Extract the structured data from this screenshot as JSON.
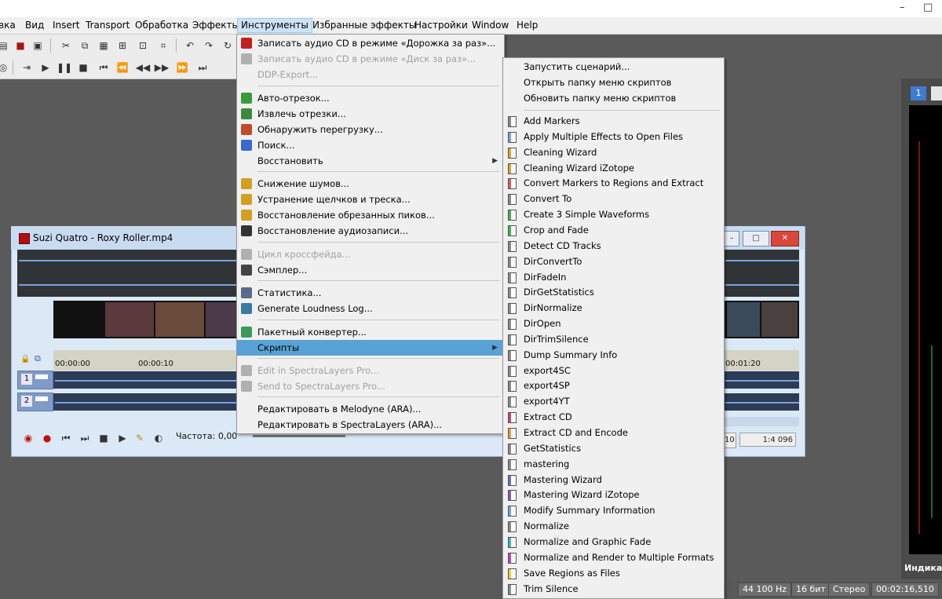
{
  "menubar": {
    "items": [
      "вка",
      "Вид",
      "Insert",
      "Transport",
      "Обработка",
      "Эффекты",
      "Инструменты",
      "Избранные эффекты",
      "Настройки",
      "Window",
      "Help"
    ],
    "active": "Инструменты",
    "window_controls": {
      "minimize": "–",
      "maximize": "□"
    }
  },
  "tools_menu": {
    "items": [
      {
        "label": "Записать аудио CD  в режиме «Дорожка за раз»...",
        "icon": "cd-record-icon",
        "enabled": true
      },
      {
        "label": "Записать аудио CD  в режиме «Диск за раз»...",
        "icon": "cd-icon",
        "enabled": false
      },
      {
        "label": "DDP-Export...",
        "icon": "",
        "enabled": false
      },
      {
        "label": "Авто-отрезок...",
        "icon": "auto-trim-icon",
        "enabled": true
      },
      {
        "label": "Извлечь отрезки...",
        "icon": "extract-regions-icon",
        "enabled": true
      },
      {
        "label": "Обнаружить перегрузку...",
        "icon": "clipping-icon",
        "enabled": true
      },
      {
        "label": "Поиск...",
        "icon": "find-icon",
        "enabled": true
      },
      {
        "label": "Восстановить",
        "icon": "",
        "enabled": true,
        "submenu": true
      },
      {
        "label": "Снижение шумов...",
        "icon": "noise-reduction-icon",
        "enabled": true
      },
      {
        "label": "Устранение щелчков и треска...",
        "icon": "click-removal-icon",
        "enabled": true
      },
      {
        "label": "Восстановление обрезанных пиков...",
        "icon": "clip-restore-icon",
        "enabled": true
      },
      {
        "label": "Восстановление аудиозаписи...",
        "icon": "vinyl-icon",
        "enabled": true
      },
      {
        "label": "Цикл кроссфейда...",
        "icon": "crossfade-icon",
        "enabled": false
      },
      {
        "label": "Сэмплер...",
        "icon": "sampler-icon",
        "enabled": true
      },
      {
        "label": "Статистика...",
        "icon": "statistics-icon",
        "enabled": true
      },
      {
        "label": "Generate Loudness Log...",
        "icon": "loudness-log-icon",
        "enabled": true
      },
      {
        "label": "Пакетный конвертер...",
        "icon": "batch-converter-icon",
        "enabled": true
      },
      {
        "label": "Скрипты",
        "icon": "",
        "enabled": true,
        "submenu": true,
        "highlighted": true
      },
      {
        "label": "Edit in SpectraLayers Pro...",
        "icon": "spectralayers-icon",
        "enabled": false
      },
      {
        "label": "Send to SpectraLayers Pro...",
        "icon": "spectralayers-icon",
        "enabled": false
      },
      {
        "label": "Редактировать в Melodyne (ARA)...",
        "icon": "",
        "enabled": true
      },
      {
        "label": "Редактировать в SpectraLayers (ARA)...",
        "icon": "",
        "enabled": true
      }
    ]
  },
  "scripts_menu": {
    "top_items": [
      "Запустить сценарий...",
      "Открыть папку меню скриптов",
      "Обновить папку меню скриптов"
    ],
    "scripts": [
      {
        "label": "Add Markers",
        "color": "#8a8a8a"
      },
      {
        "label": "Apply Multiple Effects to Open Files",
        "color": "#6ea0dd"
      },
      {
        "label": "Cleaning Wizard",
        "color": "#e89c2c"
      },
      {
        "label": "Cleaning Wizard iZotope",
        "color": "#e89c2c"
      },
      {
        "label": "Convert Markers to Regions and Extract",
        "color": "#e05a5a"
      },
      {
        "label": "Convert To",
        "color": "#8a8a8a"
      },
      {
        "label": "Create 3 Simple Waveforms",
        "color": "#3bb54a"
      },
      {
        "label": "Crop and Fade",
        "color": "#3bb54a"
      },
      {
        "label": "Detect CD Tracks",
        "color": "#8a8a8a"
      },
      {
        "label": "DirConvertTo",
        "color": "#8a8a8a"
      },
      {
        "label": "DirFadeIn",
        "color": "#8a8a8a"
      },
      {
        "label": "DirGetStatistics",
        "color": "#8a8a8a"
      },
      {
        "label": "DirNormalize",
        "color": "#8a8a8a"
      },
      {
        "label": "DirOpen",
        "color": "#8a8a8a"
      },
      {
        "label": "DirTrimSilence",
        "color": "#8a8a8a"
      },
      {
        "label": "Dump Summary Info",
        "color": "#8a8a8a"
      },
      {
        "label": "export4SC",
        "color": "#8a8a8a"
      },
      {
        "label": "export4SP",
        "color": "#8a8a8a"
      },
      {
        "label": "export4YT",
        "color": "#8a8a8a"
      },
      {
        "label": "Extract CD",
        "color": "#d63f6a"
      },
      {
        "label": "Extract CD and Encode",
        "color": "#e89c2c"
      },
      {
        "label": "GetStatistics",
        "color": "#8a8a8a"
      },
      {
        "label": "mastering",
        "color": "#8a8a8a"
      },
      {
        "label": "Mastering Wizard",
        "color": "#6a6ad0"
      },
      {
        "label": "Mastering Wizard iZotope",
        "color": "#7a5ac8"
      },
      {
        "label": "Modify Summary Information",
        "color": "#6ea0dd"
      },
      {
        "label": "Normalize",
        "color": "#8a8a8a"
      },
      {
        "label": "Normalize and Graphic Fade",
        "color": "#3bbab5"
      },
      {
        "label": "Normalize and Render to Multiple Formats",
        "color": "#c040c8"
      },
      {
        "label": "Save Regions as Files",
        "color": "#e8d02c"
      },
      {
        "label": "Trim Silence",
        "color": "#8a8a8a"
      }
    ]
  },
  "document": {
    "title": "Suzi Quatro - Roxy Roller.mp4",
    "ruler_labels": [
      "00:00:00",
      "00:00:10",
      "00:01:20"
    ],
    "tracks": [
      "1",
      "2"
    ],
    "frequency_label": "Частота: 0,00",
    "zoom_left": "10",
    "zoom_right": "1:4 096"
  },
  "status_bar": {
    "sample_rate": "44 100 Hz",
    "bit_depth": "16 бит",
    "channels": "Стерео",
    "time": "00:02:16,510"
  },
  "meter_panel": {
    "tab": "1",
    "label": "Индика"
  }
}
